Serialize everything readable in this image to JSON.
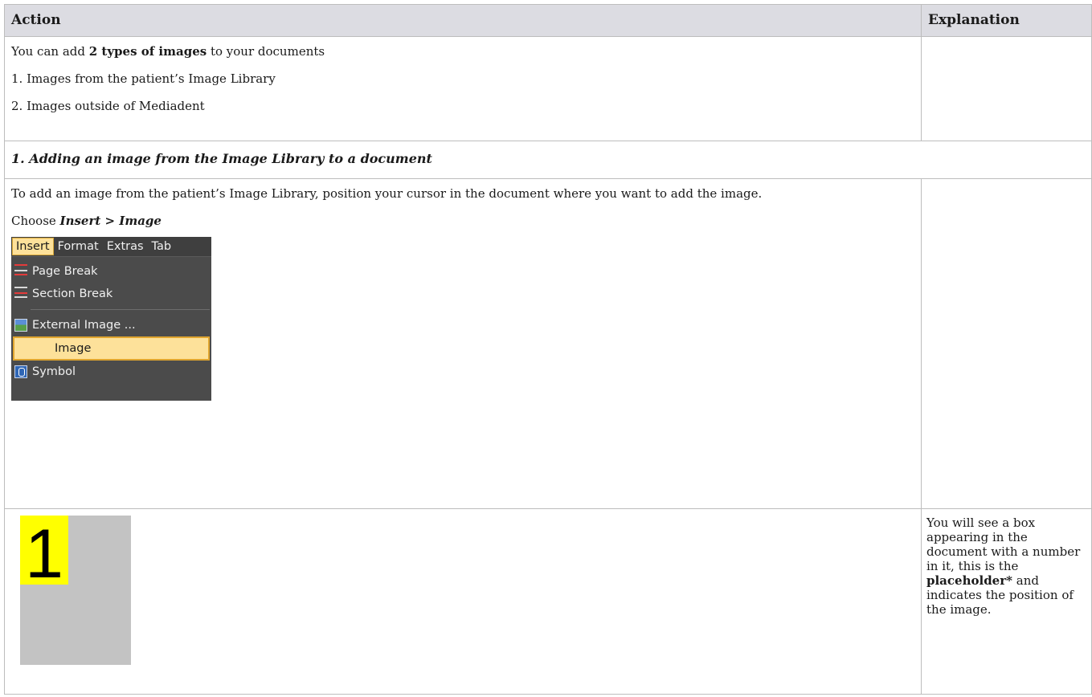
{
  "header": {
    "action": "Action",
    "explanation": "Explanation"
  },
  "intro": {
    "line1_prefix": "You can add ",
    "line1_bold": "2 types of images",
    "line1_suffix": " to your documents",
    "item1": "1. Images from the patient’s Image Library",
    "item2": "2. Images outside of Mediadent"
  },
  "section1": {
    "title": "1. Adding an image from the Image Library to a document"
  },
  "step1": {
    "text": "To add an image from the patient’s Image Library, position your cursor in the document where you want to add the image.",
    "choose_prefix": "Choose ",
    "choose_path": "Insert > Image"
  },
  "menu": {
    "bar": [
      "Insert",
      "Format",
      "Extras",
      "Tab"
    ],
    "items": [
      {
        "label": "Page Break",
        "icon": "page-break-icon"
      },
      {
        "label": "Section Break",
        "icon": "section-break-icon"
      },
      {
        "label": "External Image ...",
        "icon": "external-image-icon"
      },
      {
        "label": "Image",
        "icon": "",
        "selected": true
      },
      {
        "label": "Symbol",
        "icon": "symbol-icon"
      }
    ]
  },
  "placeholder": {
    "number": "1",
    "colors": {
      "box": "#c3c3c3",
      "badge": "#ffff00"
    }
  },
  "step2": {
    "expl_prefix": "You will see a box appearing in the document with a number in it, this is the ",
    "expl_bold": "placeholder*",
    "expl_suffix": " and indicates the position of the image."
  }
}
